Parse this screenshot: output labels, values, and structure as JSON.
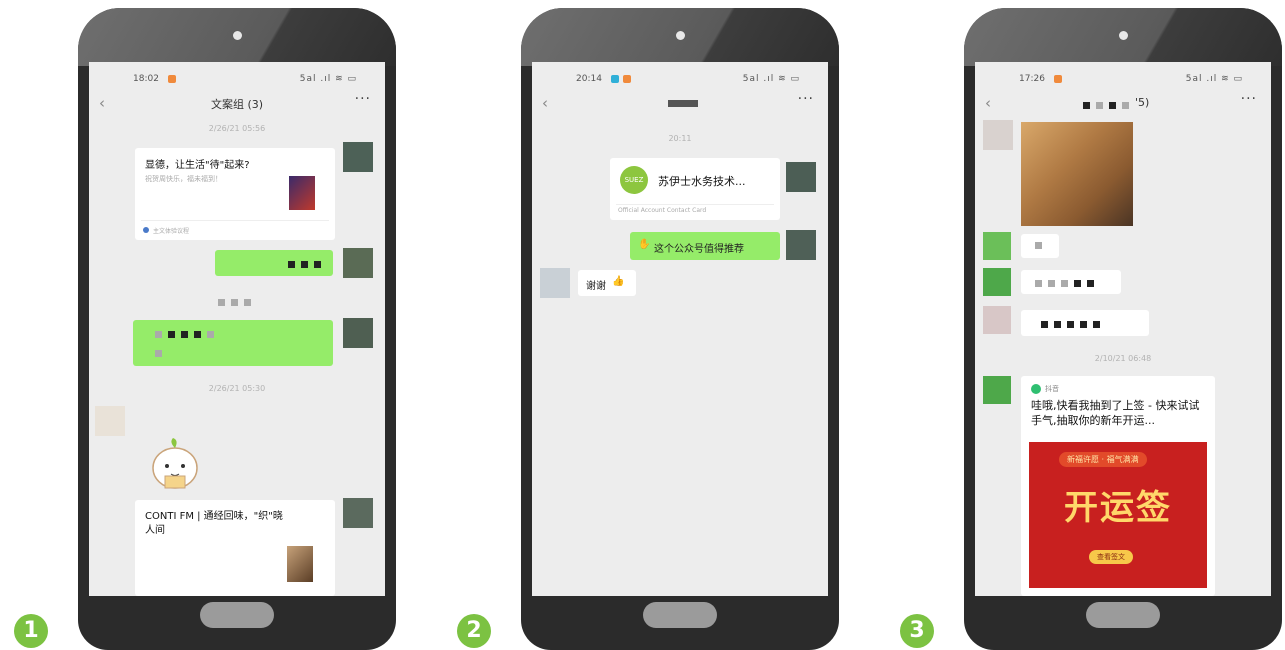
{
  "steps": [
    "1",
    "2",
    "3"
  ],
  "phone1": {
    "time": "18:02",
    "signal": "5al .ıl ≋ ▭",
    "chat_title": "文案组 (3)",
    "timestamp_top": "2/26/21 05:56",
    "article1_title": "显德，让生活\"待\"起来?",
    "article1_sub": "祝贺周快乐，福未福到！",
    "article1_source": "主文体验议程",
    "separator": "2/26/21 05:30",
    "timestamp_mid": "2/26/21 05:30",
    "article2_title": "CONTI FM | 通经回味，\"织\"晓人间"
  },
  "phone2": {
    "time": "20:14",
    "signal": "5al .ıl ≋ ▭",
    "timestamp": "20:11",
    "card_name": "苏伊士水务技术...",
    "card_logo": "SUEZ",
    "card_type": "Official Account Contact Card",
    "msg_out": "这个公众号值得推荐",
    "msg_in": "谢谢"
  },
  "phone3": {
    "time": "17:26",
    "signal": "5al .ıl ≋ ▭",
    "title_suffix": "'5)",
    "timestamp": "2/10/21 06:48",
    "app_name": "抖音",
    "share_text": "哇哦,快看我抽到了上签 - 快来试试手气,抽取你的新年开运...",
    "banner_tag": "新福许愿 · 福气满满",
    "banner_title": "开运签",
    "banner_btn": "查看签文"
  }
}
